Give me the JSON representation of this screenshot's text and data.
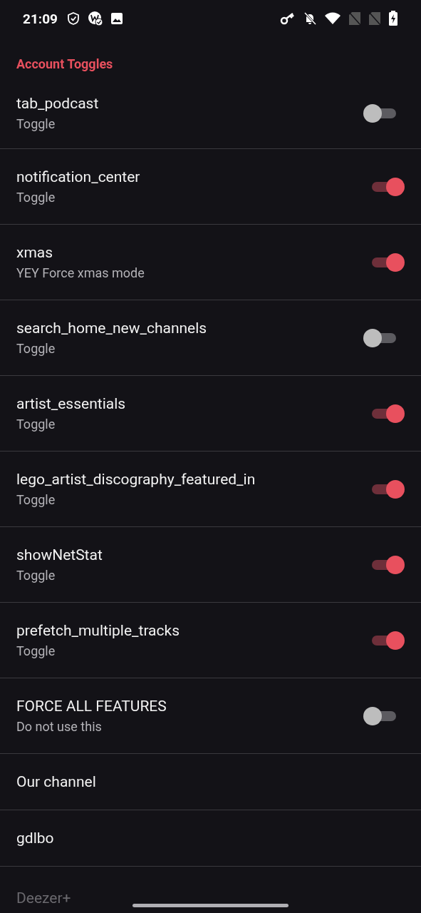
{
  "status_bar": {
    "time": "21:09"
  },
  "section_title": "Account Toggles",
  "items": [
    {
      "kind": "toggle",
      "title": "tab_podcast",
      "subtitle": "Toggle",
      "on": false
    },
    {
      "kind": "toggle",
      "title": "notification_center",
      "subtitle": "Toggle",
      "on": true
    },
    {
      "kind": "toggle",
      "title": "xmas",
      "subtitle": "YEY Force xmas mode",
      "on": true
    },
    {
      "kind": "toggle",
      "title": "search_home_new_channels",
      "subtitle": "Toggle",
      "on": false
    },
    {
      "kind": "toggle",
      "title": "artist_essentials",
      "subtitle": "Toggle",
      "on": true
    },
    {
      "kind": "toggle",
      "title": "lego_artist_discography_featured_in",
      "subtitle": "Toggle",
      "on": true
    },
    {
      "kind": "toggle",
      "title": "showNetStat",
      "subtitle": "Toggle",
      "on": true
    },
    {
      "kind": "toggle",
      "title": "prefetch_multiple_tracks",
      "subtitle": "Toggle",
      "on": true
    },
    {
      "kind": "toggle",
      "title": "FORCE ALL FEATURES",
      "subtitle": "Do not use this",
      "on": false
    },
    {
      "kind": "link",
      "title": "Our channel",
      "disabled": false
    },
    {
      "kind": "link",
      "title": "gdlbo",
      "disabled": false
    },
    {
      "kind": "link",
      "title": "Deezer+",
      "disabled": true
    }
  ]
}
